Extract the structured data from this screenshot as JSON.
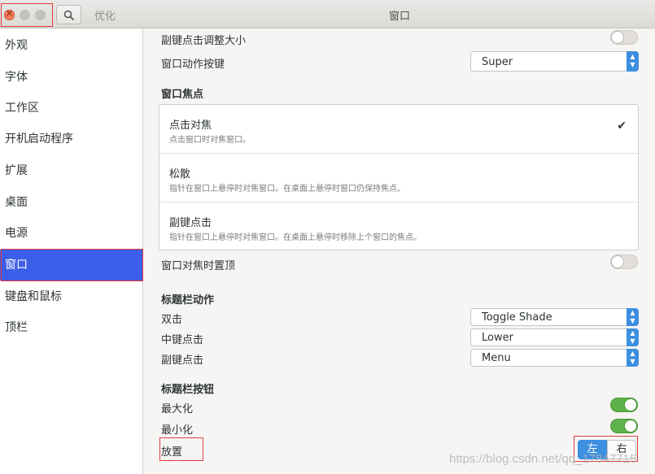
{
  "window": {
    "app_title": "优化",
    "page_title": "窗口"
  },
  "sidebar": {
    "items": [
      {
        "label": "外观"
      },
      {
        "label": "字体"
      },
      {
        "label": "工作区"
      },
      {
        "label": "开机启动程序"
      },
      {
        "label": "扩展"
      },
      {
        "label": "桌面"
      },
      {
        "label": "电源"
      },
      {
        "label": "窗口"
      },
      {
        "label": "键盘和鼠标"
      },
      {
        "label": "顶栏"
      }
    ],
    "active": "窗口"
  },
  "content": {
    "resize_secondary": {
      "label": "副键点击调整大小",
      "state": "off"
    },
    "action_key": {
      "label": "窗口动作按键",
      "value": "Super"
    },
    "focus": {
      "title": "窗口焦点",
      "options": [
        {
          "title": "点击对焦",
          "desc": "点击窗口时对焦窗口。",
          "checked": "✔"
        },
        {
          "title": "松散",
          "desc": "指针在窗口上悬停时对焦窗口。在桌面上悬停时窗口仍保持焦点。",
          "checked": ""
        },
        {
          "title": "副键点击",
          "desc": "指针在窗口上悬停时对焦窗口。在桌面上悬停时移除上个窗口的焦点。",
          "checked": ""
        }
      ]
    },
    "raise_on_focus": {
      "label": "窗口对焦时置顶",
      "state": "off"
    },
    "titlebar_actions": {
      "title": "标题栏动作",
      "double": {
        "label": "双击",
        "value": "Toggle Shade"
      },
      "middle": {
        "label": "中键点击",
        "value": "Lower"
      },
      "secondary": {
        "label": "副键点击",
        "value": "Menu"
      }
    },
    "titlebar_buttons": {
      "title": "标题栏按钮",
      "maximize": {
        "label": "最大化",
        "state": "on"
      },
      "minimize": {
        "label": "最小化",
        "state": "on"
      },
      "placement": {
        "label": "放置",
        "left": "左",
        "right": "右",
        "selected": "左"
      }
    }
  },
  "watermark": "https://blog.csdn.net/qq_17847715",
  "colors": {
    "accent": "#3d8fe0",
    "sidebar_active": "#3d5ee8",
    "toggle_on": "#5fb24a",
    "highlight_box": "#e03c3c"
  }
}
